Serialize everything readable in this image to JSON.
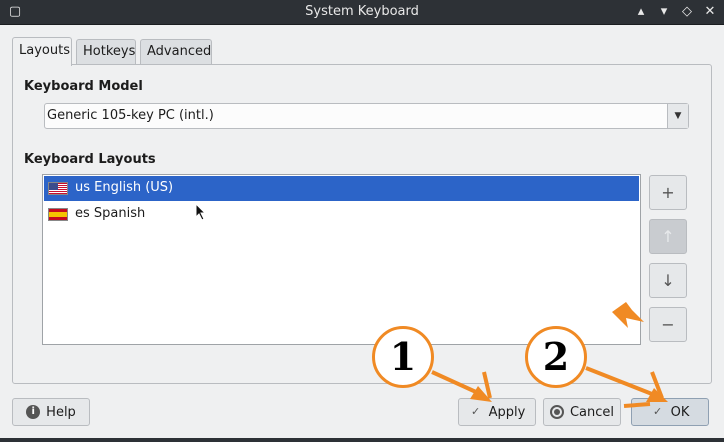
{
  "window": {
    "title": "System Keyboard",
    "controls": {
      "help": "?",
      "maximize": "▴",
      "restore": "◇",
      "close": "✕"
    }
  },
  "tabs": [
    {
      "label": "Layouts",
      "active": true
    },
    {
      "label": "Hotkeys",
      "active": false
    },
    {
      "label": "Advanced",
      "active": false
    }
  ],
  "keyboard_model": {
    "heading": "Keyboard Model",
    "selected": "Generic 105-key PC (intl.)"
  },
  "keyboard_layouts": {
    "heading": "Keyboard Layouts",
    "items": [
      {
        "label": "us English (US)",
        "flag": "us-flag-icon",
        "selected": true
      },
      {
        "label": "es Spanish",
        "flag": "es-flag-icon",
        "selected": false
      }
    ],
    "side_buttons": {
      "add": "+",
      "up": "↑",
      "down": "↓",
      "remove": "−"
    }
  },
  "buttons": {
    "help": "Help",
    "apply": "Apply",
    "cancel": "Cancel",
    "ok": "OK"
  },
  "annotations": {
    "badge_1": "1",
    "badge_2": "2",
    "accent_color": "#f08a24"
  }
}
